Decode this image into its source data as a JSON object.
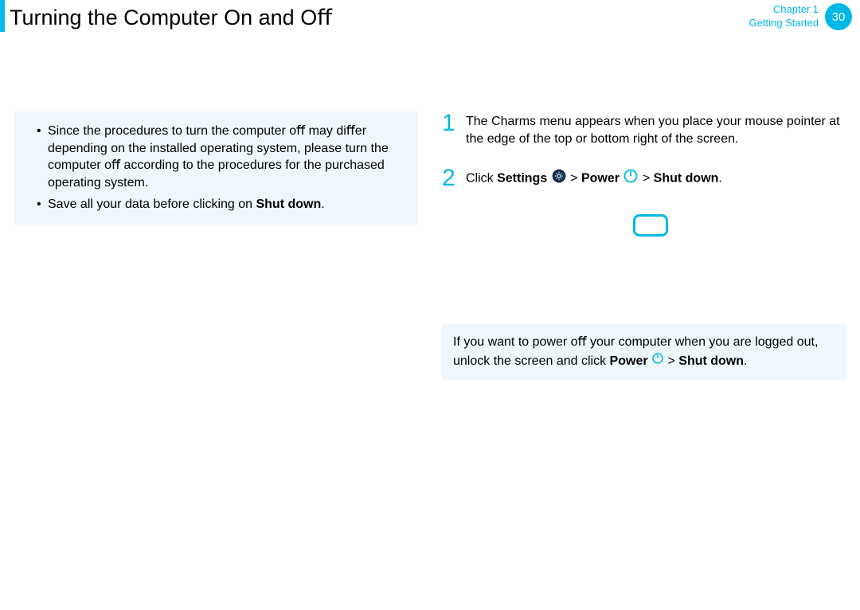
{
  "header": {
    "title": "Turning the Computer On and Oﬀ",
    "chapter_line1": "Chapter 1",
    "chapter_line2": "Getting Started",
    "page_number": "30"
  },
  "left": {
    "note_item1": "Since the procedures to turn the computer oﬀ may diﬀer depending on the installed operating system, please turn the computer oﬀ according to the procedures for the purchased operating system.",
    "note_item2_a": "Save all your data before clicking on ",
    "note_item2_b": "Shut down",
    "note_item2_c": "."
  },
  "right": {
    "step1_num": "1",
    "step1_text": "The Charms menu appears when you place your mouse pointer at the edge of the top or bottom right of the screen.",
    "step2_num": "2",
    "step2_a": "Click ",
    "step2_settings": "Settings",
    "step2_b": " > ",
    "step2_power": "Power",
    "step2_c": " > ",
    "step2_shutdown": "Shut down",
    "step2_d": ".",
    "tip_a": "If you want to power oﬀ your computer when you are logged out, unlock the screen and click ",
    "tip_power": "Power",
    "tip_b": " > ",
    "tip_shutdown": "Shut down",
    "tip_c": "."
  }
}
